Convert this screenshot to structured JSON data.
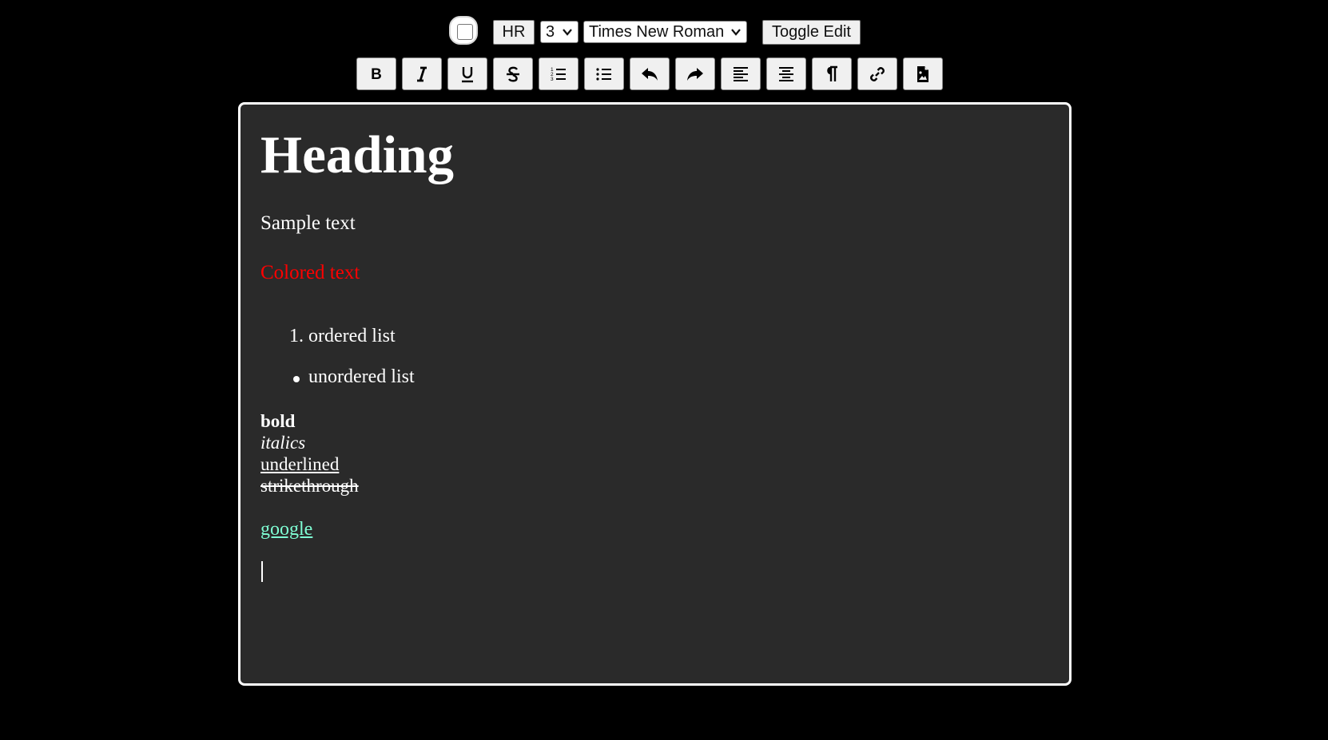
{
  "top_controls": {
    "hr_label": "HR",
    "heading_level": "3",
    "font_family": "Times New Roman",
    "toggle_edit_label": "Toggle Edit"
  },
  "toolbar": {
    "buttons": [
      {
        "name": "bold-button",
        "icon": "bold-icon"
      },
      {
        "name": "italic-button",
        "icon": "italic-icon"
      },
      {
        "name": "underline-button",
        "icon": "underline-icon"
      },
      {
        "name": "strikethrough-button",
        "icon": "strikethrough-icon"
      },
      {
        "name": "ordered-list-button",
        "icon": "ordered-list-icon"
      },
      {
        "name": "unordered-list-button",
        "icon": "unordered-list-icon"
      },
      {
        "name": "undo-button",
        "icon": "undo-icon"
      },
      {
        "name": "redo-button",
        "icon": "redo-icon"
      },
      {
        "name": "align-left-button",
        "icon": "align-left-icon"
      },
      {
        "name": "align-center-button",
        "icon": "align-center-icon"
      },
      {
        "name": "paragraph-button",
        "icon": "paragraph-icon"
      },
      {
        "name": "link-button",
        "icon": "link-icon"
      },
      {
        "name": "insert-image-button",
        "icon": "file-image-icon"
      }
    ]
  },
  "editor": {
    "heading": "Heading",
    "sample_text": "Sample text",
    "colored_text": "Colored text",
    "colored_text_color": "#ff0000",
    "ordered_list_number": "1.",
    "ordered_list_item": "ordered list",
    "unordered_list_item": "unordered list",
    "bold": "bold",
    "italics": "italics",
    "underlined": "underlined",
    "strikethrough": "strikethrough",
    "link_text": "google",
    "link_color": "#7fffd4"
  },
  "colors": {
    "page_bg": "#000000",
    "editor_bg": "#2a2a2a",
    "editor_border": "#ffffff"
  }
}
